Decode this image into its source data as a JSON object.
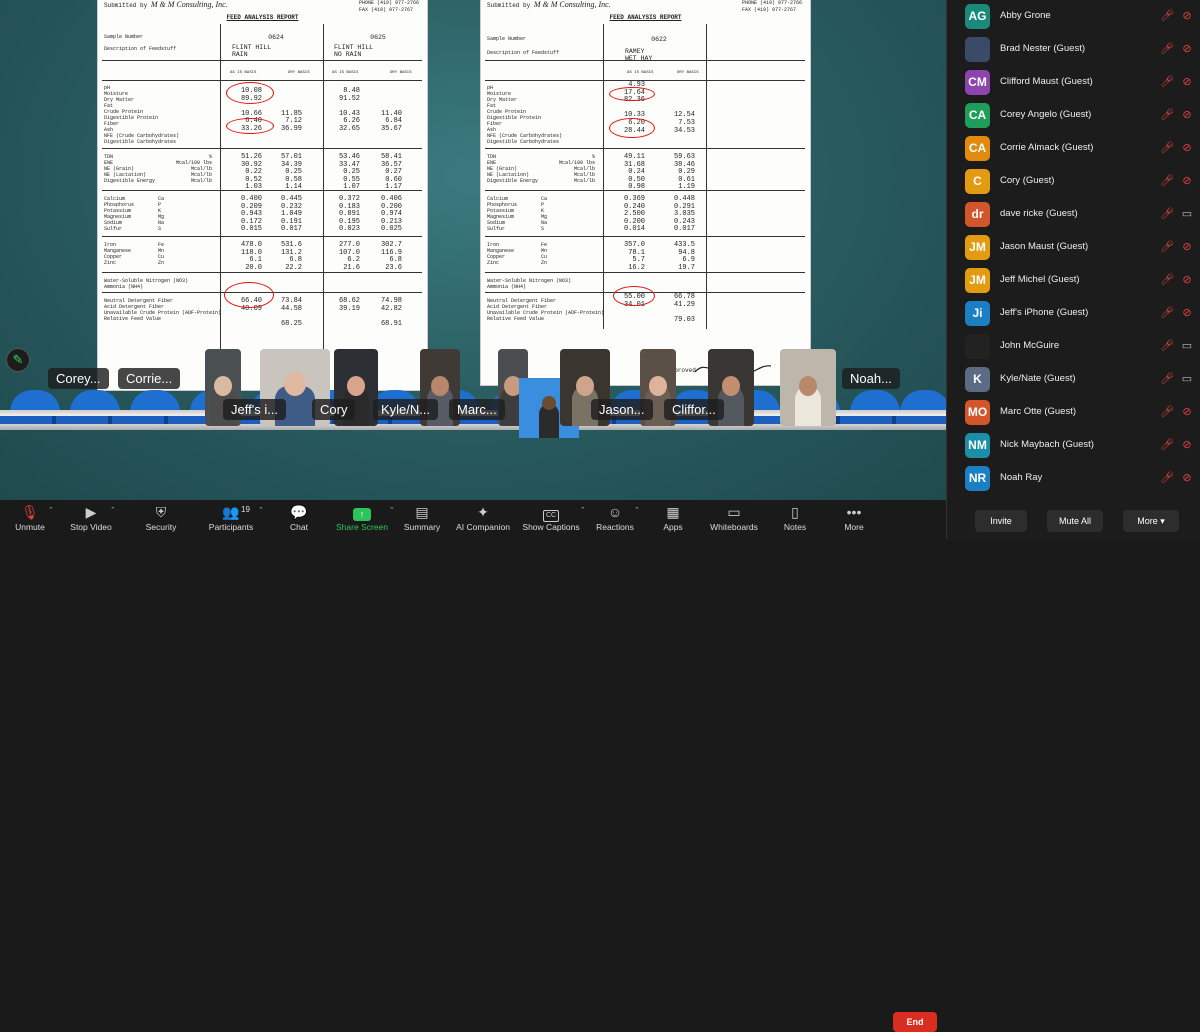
{
  "doc_left": {
    "submitted_by": "Submitted by",
    "company": "M & M Consulting, Inc.",
    "phone": "PHONE (419) 977-2766\nFAX (419) 977-2767",
    "report_title": "FEED ANALYSIS REPORT",
    "sample_number_label": "Sample Number",
    "description_label": "Description of Feedstuff",
    "col1_sample": "0624",
    "col1_desc": "FLINT HILL\nRAIN",
    "col2_sample": "0625",
    "col2_desc": "FLINT HILL\nNO RAIN",
    "basis_labels": [
      "AS IS BASIS",
      "DRY BASIS",
      "AS IS BASIS",
      "DRY BASIS"
    ],
    "nutrients_1": "pH\nMoisture\nDry Matter\nFat\nCrude Protein\nDigestible Protein\nFiber\nAsh\nNFE (Crude Carbohydrates)\nDigestible Carbohydrates",
    "nutrients_2": "TDN\nENE\nNE (Grain)\nNE (Lactation)\nDigestible Energy",
    "units_2": "%\nMcal/100 lbs\nMcal/lb\nMcal/lb\nMcal/lb",
    "minerals": "Calcium\nPhosphorus\nPotassium\nMagnesium\nSodium\nSulfur",
    "mineral_syms": "Ca\nP\nK\nMg\nNa\nS",
    "traces": "Iron\nManganese\nCopper\nZinc",
    "trace_syms": "Fe\nMn\nCu\nZn",
    "nitrogen": "Water-Soluble Nitrogen (NO3)\nAmmonia (NH4)",
    "fiber_block": "Neutral Detergent Fiber\nAcid Detergent Fiber\nUnavailable Crude Protein (ADF-Protein)\nRelative Feed Value",
    "c1_a1": "10.08\n89.92\n\n10.66\n6.40\n33.26",
    "c1_d1": "\n\n\n11.85\n7.12\n36.99",
    "c2_a1": "8.48\n91.52\n\n10.43\n6.26\n32.65",
    "c2_d1": "\n\n\n11.40\n6.84\n35.67",
    "c1_a2": "51.26\n30.92\n0.22\n0.52\n1.03",
    "c1_d2": "57.01\n34.39\n0.25\n0.58\n1.14",
    "c2_a2": "53.46\n33.47\n0.25\n0.55\n1.07",
    "c2_d2": "58.41\n36.57\n0.27\n0.60\n1.17",
    "c1_a3": "0.400\n0.209\n0.943\n0.172\n0.015",
    "c1_d3": "0.445\n0.232\n1.049\n0.191\n0.017",
    "c2_a3": "0.372\n0.183\n0.891\n0.195\n0.023",
    "c2_d3": "0.406\n0.200\n0.974\n0.213\n0.025",
    "c1_a4": "478.0\n118.0\n6.1\n20.0",
    "c1_d4": "531.6\n131.2\n6.8\n22.2",
    "c2_a4": "277.0\n107.0\n6.2\n21.6",
    "c2_d4": "302.7\n116.9\n6.8\n23.6",
    "c1_a5": "66.40\n40.09",
    "c1_d5": "73.84\n44.58\n\n68.25",
    "c2_a5": "68.62\n39.19",
    "c2_d5": "74.98\n42.82\n\n68.91"
  },
  "doc_right": {
    "submitted_by": "Submitted by",
    "company": "M & M Consulting, Inc.",
    "phone": "PHONE (419) 977-2766\nFAX (419) 977-2767",
    "report_title": "FEED ANALYSIS REPORT",
    "sample_number_label": "Sample Number",
    "description_label": "Description of Feedstuff",
    "col1_sample": "0622",
    "col1_desc": "RAMEY\nWET HAY",
    "basis_labels": [
      "AS IS BASIS",
      "DRY BASIS"
    ],
    "c1_a1": "4.93\n17.64\n82.36\n\n10.33\n6.20\n28.44",
    "c1_d1": "\n\n\n\n12.54\n7.53\n34.53",
    "c1_a2": "49.11\n31.68\n0.24\n0.50\n0.98",
    "c1_d2": "59.63\n38.46\n0.29\n0.61\n1.19",
    "c1_a3": "0.369\n0.240\n2.500\n0.200\n0.014",
    "c1_d3": "0.448\n0.291\n3.035\n0.243\n0.017",
    "c1_a4": "357.0\n78.1\n5.7\n16.2",
    "c1_d4": "433.5\n94.8\n6.9\n19.7",
    "c1_a5": "55.00\n34.01",
    "c1_d5": "66.78\n41.29\n\n79.03",
    "approved": "Approved"
  },
  "video_tiles": [
    {
      "name": "Corey..."
    },
    {
      "name": "Corrie..."
    },
    {
      "name": "Jeff's i..."
    },
    {
      "name": "Cory"
    },
    {
      "name": "Kyle/N..."
    },
    {
      "name": "Marc..."
    },
    {
      "name": "Jason..."
    },
    {
      "name": "Cliffor..."
    },
    {
      "name": "Noah..."
    }
  ],
  "participants": [
    {
      "initials": "AG",
      "name": "Abby Grone",
      "color": "#1a8a7a",
      "cam": "off"
    },
    {
      "initials": "",
      "name": "Brad Nester (Guest)",
      "color": "#3b4a66",
      "cam": "off"
    },
    {
      "initials": "CM",
      "name": "Clifford Maust (Guest)",
      "color": "#8e44ad",
      "cam": "off"
    },
    {
      "initials": "CA",
      "name": "Corey Angelo (Guest)",
      "color": "#1e9e5a",
      "cam": "off"
    },
    {
      "initials": "CA",
      "name": "Corrie Almack (Guest)",
      "color": "#e08a10",
      "cam": "off"
    },
    {
      "initials": "C",
      "name": "Cory (Guest)",
      "color": "#e39b12",
      "cam": "off"
    },
    {
      "initials": "dr",
      "name": "dave ricke (Guest)",
      "color": "#d3562a",
      "cam": "on"
    },
    {
      "initials": "JM",
      "name": "Jason Maust (Guest)",
      "color": "#e39b12",
      "cam": "off"
    },
    {
      "initials": "JM",
      "name": "Jeff Michel (Guest)",
      "color": "#e39b12",
      "cam": "off"
    },
    {
      "initials": "Ji",
      "name": "Jeff's iPhone (Guest)",
      "color": "#1b7fc4",
      "cam": "off"
    },
    {
      "initials": "",
      "name": "John McGuire",
      "color": "#222222",
      "cam": "on"
    },
    {
      "initials": "K",
      "name": "Kyle/Nate (Guest)",
      "color": "#5b6b84",
      "cam": "on"
    },
    {
      "initials": "MO",
      "name": "Marc Otte (Guest)",
      "color": "#d3562a",
      "cam": "off"
    },
    {
      "initials": "NM",
      "name": "Nick Maybach (Guest)",
      "color": "#1b8fa8",
      "cam": "off"
    },
    {
      "initials": "NR",
      "name": "Noah Ray",
      "color": "#1b7fc4",
      "cam": "off"
    }
  ],
  "sidebar_buttons": {
    "invite": "Invite",
    "mute_all": "Mute All",
    "more": "More"
  },
  "toolbar": {
    "unmute": "Unmute",
    "stop_video": "Stop Video",
    "security": "Security",
    "participants": "Participants",
    "participants_count": "19",
    "chat": "Chat",
    "share_screen": "Share Screen",
    "summary": "Summary",
    "ai_companion": "AI Companion",
    "show_captions": "Show Captions",
    "reactions": "Reactions",
    "apps": "Apps",
    "whiteboards": "Whiteboards",
    "notes": "Notes",
    "more": "More",
    "end": "End"
  },
  "colors": {
    "share_green": "#2fc45a",
    "end_red": "#d92d20",
    "muted_red": "#e0443f"
  }
}
